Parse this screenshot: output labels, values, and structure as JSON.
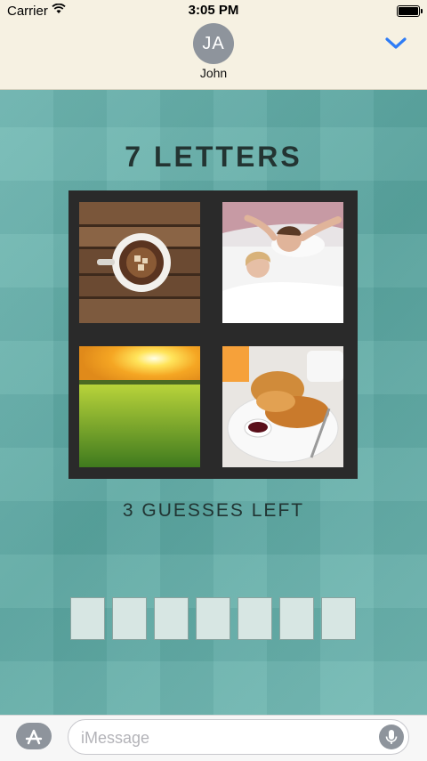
{
  "status_bar": {
    "carrier": "Carrier",
    "time": "3:05 PM"
  },
  "header": {
    "avatar_initials": "JA",
    "contact_name": "John"
  },
  "game": {
    "title": "7 LETTERS",
    "guesses_left": "3 GUESSES LEFT",
    "letter_count": 7,
    "images": [
      "coffee-cup-on-wood",
      "couple-waking-up-in-bed",
      "sunrise-over-field",
      "croissants-breakfast"
    ]
  },
  "input": {
    "placeholder": "iMessage"
  },
  "colors": {
    "accent": "#2e7cf6",
    "header_bg": "#f6f1e2",
    "game_bg": "#5fb0aa",
    "grid_frame": "#2a2a2a"
  }
}
